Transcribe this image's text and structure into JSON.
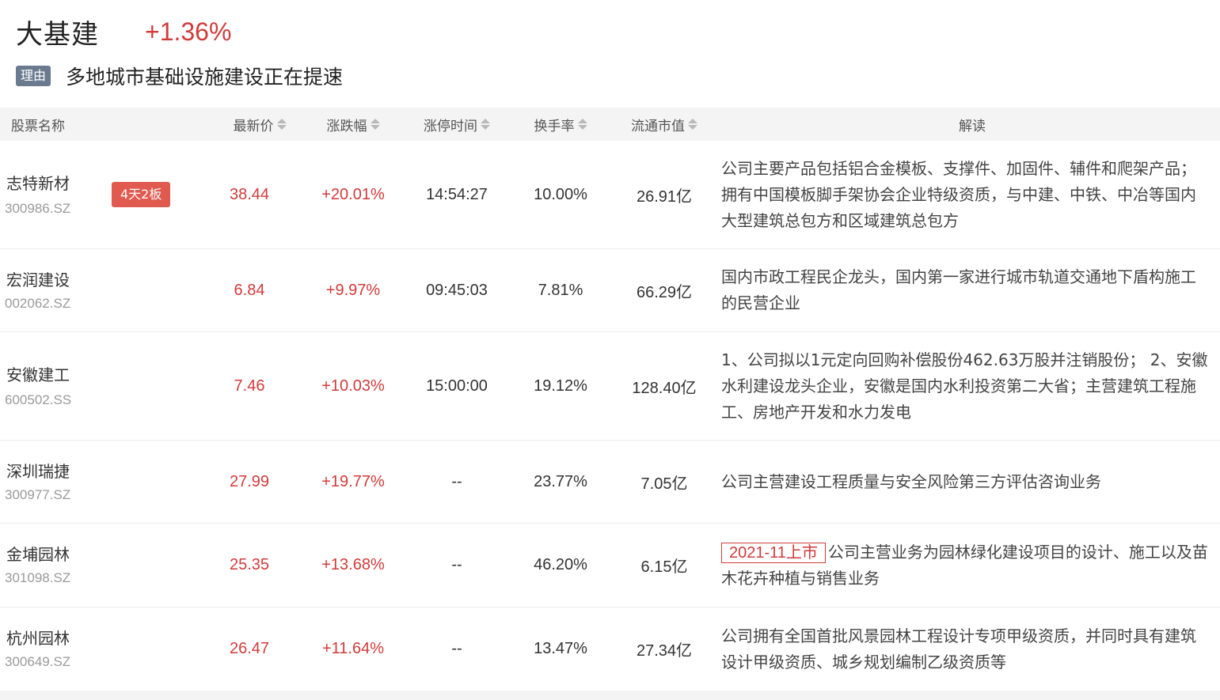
{
  "sector": {
    "name": "大基建",
    "change": "+1.36%"
  },
  "reason": {
    "badge": "理由",
    "text": "多地城市基础设施建设正在提速"
  },
  "columns": {
    "name": "股票名称",
    "price": "最新价",
    "change": "涨跌幅",
    "limit_time": "涨停时间",
    "turnover": "换手率",
    "float_cap": "流通市值",
    "desc": "解读"
  },
  "rows": [
    {
      "name": "志特新材",
      "code": "300986.SZ",
      "badge": "4天2板",
      "price": "38.44",
      "change": "+20.01%",
      "limit_time": "14:54:27",
      "turnover": "10.00%",
      "float_cap": "26.91亿",
      "desc": "公司主要产品包括铝合金模板、支撑件、加固件、辅件和爬架产品；拥有中国模板脚手架协会企业特级资质，与中建、中铁、中冶等国内大型建筑总包方和区域建筑总包方"
    },
    {
      "name": "宏润建设",
      "code": "002062.SZ",
      "price": "6.84",
      "change": "+9.97%",
      "limit_time": "09:45:03",
      "turnover": "7.81%",
      "float_cap": "66.29亿",
      "desc": "国内市政工程民企龙头，国内第一家进行城市轨道交通地下盾构施工的民营企业"
    },
    {
      "name": "安徽建工",
      "code": "600502.SS",
      "price": "7.46",
      "change": "+10.03%",
      "limit_time": "15:00:00",
      "turnover": "19.12%",
      "float_cap": "128.40亿",
      "desc": "1、公司拟以1元定向回购补偿股份462.63万股并注销股份； 2、安徽水利建设龙头企业，安徽是国内水利投资第二大省；主营建筑工程施工、房地产开发和水力发电"
    },
    {
      "name": "深圳瑞捷",
      "code": "300977.SZ",
      "price": "27.99",
      "change": "+19.77%",
      "limit_time": "--",
      "turnover": "23.77%",
      "float_cap": "7.05亿",
      "desc": "公司主营建设工程质量与安全风险第三方评估咨询业务"
    },
    {
      "name": "金埔园林",
      "code": "301098.SZ",
      "price": "25.35",
      "change": "+13.68%",
      "limit_time": "--",
      "turnover": "46.20%",
      "float_cap": "6.15亿",
      "tag": "2021-11上市",
      "desc": "公司主营业务为园林绿化建设项目的设计、施工以及苗木花卉种植与销售业务"
    },
    {
      "name": "杭州园林",
      "code": "300649.SZ",
      "price": "26.47",
      "change": "+11.64%",
      "limit_time": "--",
      "turnover": "13.47%",
      "float_cap": "27.34亿",
      "desc": "公司拥有全国首批风景园林工程设计专项甲级资质，并同时具有建筑设计甲级资质、城乡规划编制乙级资质等"
    }
  ]
}
